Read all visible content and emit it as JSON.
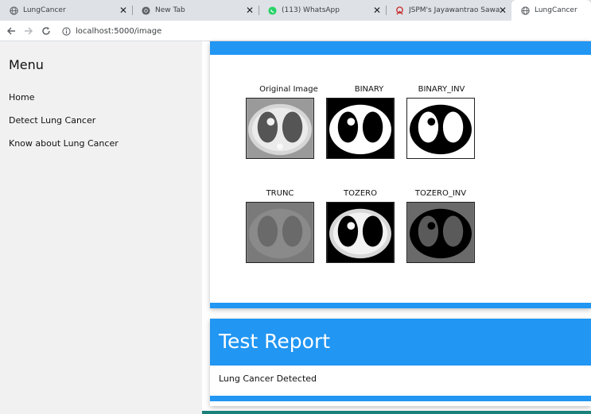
{
  "browser": {
    "tabs": [
      {
        "title": "LungCancer",
        "icon": "globe-icon",
        "active": false
      },
      {
        "title": "New Tab",
        "icon": "chrome-icon",
        "active": false
      },
      {
        "title": "(113) WhatsApp",
        "icon": "whatsapp-icon",
        "active": false
      },
      {
        "title": "JSPM's Jayawantrao Sawant Colle",
        "icon": "college-icon",
        "active": false
      },
      {
        "title": "LungCancer",
        "icon": "globe-icon",
        "active": true
      }
    ],
    "url": "localhost:5000/image"
  },
  "sidebar": {
    "heading": "Menu",
    "links": [
      "Home",
      "Detect Lung Cancer",
      "Know about Lung Cancer"
    ]
  },
  "images": {
    "labels": [
      "Original Image",
      "BINARY",
      "BINARY_INV",
      "TRUNC",
      "TOZERO",
      "TOZERO_INV"
    ]
  },
  "report": {
    "title": "Test Report",
    "result": "Lung Cancer Detected"
  },
  "colors": {
    "accent": "#2196f3",
    "sidebar_bg": "#f1f1f1",
    "footer": "#19807a"
  }
}
